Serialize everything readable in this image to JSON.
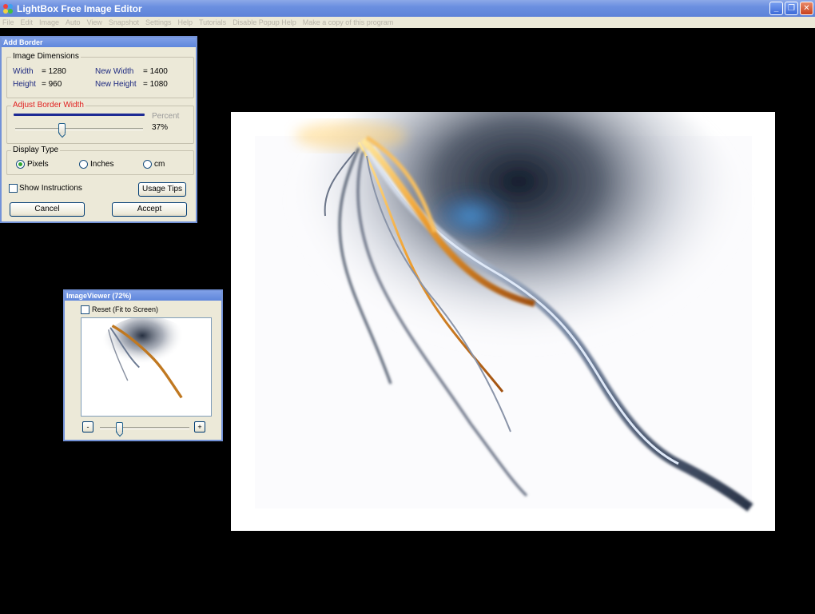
{
  "app": {
    "title": "LightBox Free Image Editor",
    "window_buttons": {
      "minimize": "_",
      "restore": "❐",
      "close": "✕"
    }
  },
  "menu": [
    "File",
    "Edit",
    "Image",
    "Auto",
    "View",
    "Snapshot",
    "Settings",
    "Help",
    "Tutorials",
    "Disable Popup Help",
    "Make a copy of this program"
  ],
  "add_border": {
    "title": "Add Border",
    "dimensions": {
      "legend": "Image Dimensions",
      "width_label": "Width",
      "width_value": "= 1280",
      "height_label": "Height",
      "height_value": "= 960",
      "new_width_label": "New Width",
      "new_width_value": "= 1400",
      "new_height_label": "New Height",
      "new_height_value": "= 1080"
    },
    "border_width": {
      "legend": "Adjust Border Width",
      "percent_label": "Percent",
      "percent_value": "37%",
      "slider_fraction": 0.37,
      "legend_color": "#e02020"
    },
    "display_type": {
      "legend": "Display Type",
      "options": [
        "Pixels",
        "Inches",
        "cm"
      ],
      "selected": "Pixels"
    },
    "show_instructions": "Show Instructions",
    "usage_tips": "Usage Tips",
    "cancel": "Cancel",
    "accept": "Accept"
  },
  "image_viewer": {
    "title": "ImageViewer (72%)",
    "reset_label": "Reset (Fit to Screen)",
    "zoom_minus": "-",
    "zoom_plus": "+",
    "zoom_fraction": 0.22
  },
  "colors": {
    "titlebar": "#6b8fe0",
    "dialog_bg": "#ece9d8",
    "label_blue": "#1e2a80",
    "accent_orange": "#f0a030",
    "accent_blue": "#3a78c8"
  }
}
